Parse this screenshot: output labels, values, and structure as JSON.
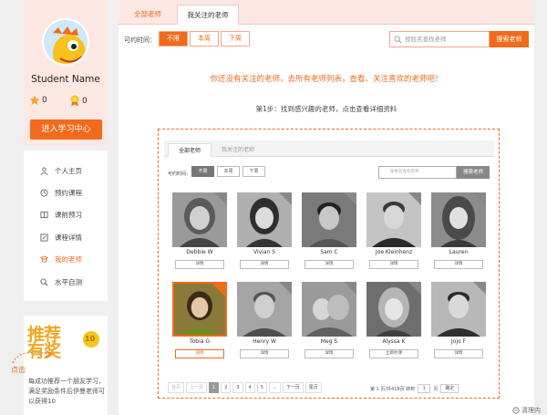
{
  "colors": {
    "accent": "#f26a1b",
    "profile_bg": "#fde8e4",
    "page_bg": "#efefef"
  },
  "sidebar": {
    "username": "Student Name",
    "stars": "0",
    "medals": "0",
    "enter_center": "进入学习中心",
    "menu": [
      {
        "label": "个人主页",
        "icon": "person-icon"
      },
      {
        "label": "预约课程",
        "icon": "clock-icon"
      },
      {
        "label": "课前预习",
        "icon": "book-icon"
      },
      {
        "label": "课程详情",
        "icon": "edit-icon"
      },
      {
        "label": "我的老师",
        "icon": "teacher-icon",
        "active": true
      },
      {
        "label": "水平自测",
        "icon": "search-icon"
      }
    ],
    "promo": {
      "title_line1": "推荐",
      "title_line2": "有奖",
      "badge": "10",
      "text": "每成功推荐一个朋友学习，满足奖励条件后伊曼老师可以获得10"
    }
  },
  "tabs": {
    "all": "全部老师",
    "followed": "我关注的老师"
  },
  "filter": {
    "label": "可约时间：",
    "options": [
      "不限",
      "本周",
      "下周"
    ],
    "selected": "不限"
  },
  "search": {
    "placeholder": "按姓名查找老师",
    "button": "搜索老师"
  },
  "notice": "你还没有关注的老师，去所有老师列表，查看、关注喜欢的老师吧！",
  "step1": "第1步：找到感兴趣的老师，点击查看详细资料",
  "click_label": "点击",
  "demo": {
    "tabs": {
      "all": "全部老师",
      "followed": "我关注的老师"
    },
    "filter": {
      "label": "可约时间：",
      "options": [
        "不限",
        "本周",
        "下周"
      ]
    },
    "search": {
      "placeholder": "按姓名查找老师",
      "button": "搜索老师"
    },
    "teachers": [
      {
        "name": "Debbie W",
        "button": "详情"
      },
      {
        "name": "Vivian S",
        "button": "详情"
      },
      {
        "name": "Sam C",
        "button": "详情"
      },
      {
        "name": "Joe Kleinhenz",
        "button": "详情"
      },
      {
        "name": "Lauren",
        "button": "详情"
      },
      {
        "name": "Tobia G",
        "button": "详情"
      },
      {
        "name": "Henry W",
        "button": "详情"
      },
      {
        "name": "Meg S",
        "button": "详情"
      },
      {
        "name": "Alyssa K",
        "button": "立即约课"
      },
      {
        "name": "Jojo F",
        "button": "详情"
      }
    ],
    "pager": {
      "first": "首页",
      "prev": "上一页",
      "pages": [
        "1",
        "2",
        "3",
        "4",
        "5",
        "..."
      ],
      "next": "下一页",
      "last": "尾页",
      "info": "第 1 页/共418页 转到",
      "goto": "1",
      "page_unit": "页",
      "ok": "确定"
    }
  },
  "clear_text": "清理内"
}
